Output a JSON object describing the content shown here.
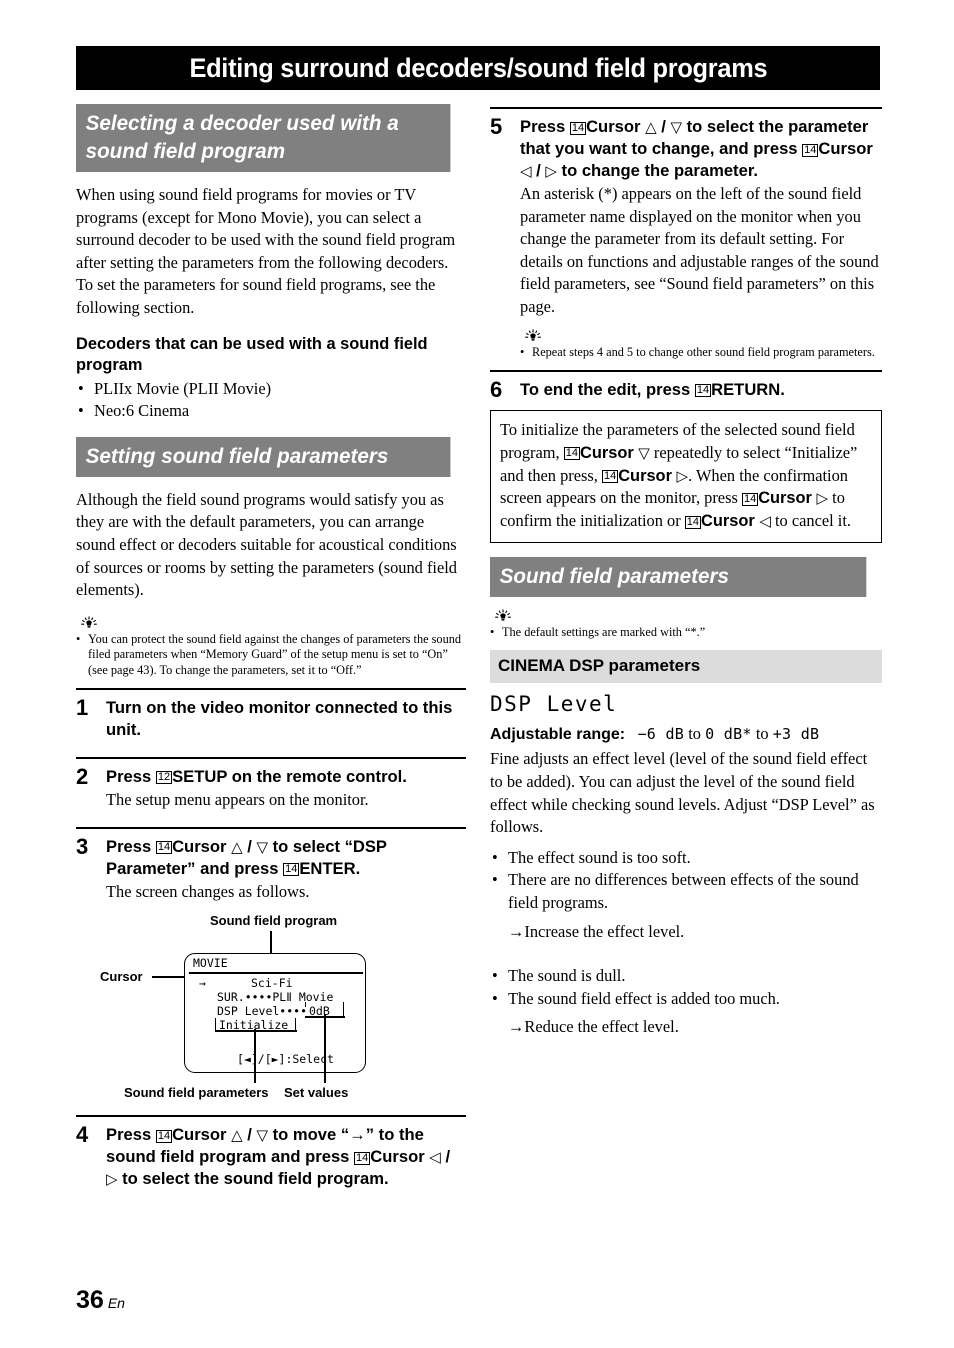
{
  "page": {
    "title": "Editing surround decoders/sound field programs",
    "number": "36",
    "language": "En"
  },
  "left": {
    "section1": {
      "heading": "Selecting a decoder used with a sound field program",
      "paragraph": "When using sound field programs for movies or TV programs (except for Mono Movie), you can select a surround decoder to be used with the sound field program after setting the parameters from the following decoders. To set the parameters for sound field programs, see the following section.",
      "subheading": "Decoders that can be used with a sound field program",
      "bullets": [
        "PLIIx Movie (PLII Movie)",
        "Neo:6 Cinema"
      ]
    },
    "section2": {
      "heading": "Setting sound field parameters",
      "paragraph": "Although the field sound programs would satisfy you as they are with the default parameters, you can arrange sound effect or decoders suitable for acoustical conditions of sources or rooms by setting the parameters (sound field elements).",
      "tip": "You can protect the sound field against the changes of parameters the sound filed parameters when “Memory Guard” of the setup menu is set to “On” (see page 43). To change the parameters, set it to “Off.”"
    },
    "steps": [
      {
        "num": "1",
        "head_parts": [
          {
            "t": "text",
            "v": "Turn on the video monitor connected to this unit."
          }
        ],
        "sub": ""
      },
      {
        "num": "2",
        "head_parts": [
          {
            "t": "text",
            "v": "Press "
          },
          {
            "t": "key",
            "v": "12"
          },
          {
            "t": "text",
            "v": "SETUP"
          },
          {
            "t": "text",
            "v": " on the remote control."
          }
        ],
        "sub": "The setup menu appears on the monitor."
      },
      {
        "num": "3",
        "head_parts": [
          {
            "t": "text",
            "v": "Press "
          },
          {
            "t": "key",
            "v": "14"
          },
          {
            "t": "text",
            "v": "Cursor "
          },
          {
            "t": "glyph",
            "v": "△"
          },
          {
            "t": "text",
            "v": " / "
          },
          {
            "t": "glyph",
            "v": "▽"
          },
          {
            "t": "text",
            "v": " to select “DSP Parameter” and press "
          },
          {
            "t": "key",
            "v": "14"
          },
          {
            "t": "text",
            "v": "ENTER."
          }
        ],
        "sub": "The screen changes as follows."
      }
    ],
    "step4": {
      "num": "4",
      "head_parts": [
        {
          "t": "text",
          "v": "Press "
        },
        {
          "t": "key",
          "v": "14"
        },
        {
          "t": "text",
          "v": "Cursor "
        },
        {
          "t": "glyph",
          "v": "△"
        },
        {
          "t": "text",
          "v": " / "
        },
        {
          "t": "glyph",
          "v": "▽"
        },
        {
          "t": "text",
          "v": " to move “→” to the sound field program and press "
        },
        {
          "t": "key",
          "v": "14"
        },
        {
          "t": "text",
          "v": "Cursor "
        },
        {
          "t": "glyph",
          "v": "◁"
        },
        {
          "t": "text",
          "v": " / "
        },
        {
          "t": "glyph",
          "v": "▷"
        },
        {
          "t": "text",
          "v": " to select the sound field program."
        }
      ]
    },
    "figure": {
      "label_top": "Sound field program",
      "label_cursor": "Cursor",
      "label_bottom_left": "Sound field parameters",
      "label_bottom_right": "Set values",
      "osd": {
        "title": "MOVIE",
        "cursor_arrow": "→",
        "program": "Sci-Fi",
        "line_sur": "SUR.••••PLⅡ Movie",
        "line_dsp": "DSP Level••••",
        "dsp_value": "0dB",
        "line_init": "Initialize",
        "line_select": "[◄]/[►]:Select"
      }
    }
  },
  "right": {
    "step5": {
      "num": "5",
      "head_parts": [
        {
          "t": "text",
          "v": "Press "
        },
        {
          "t": "key",
          "v": "14"
        },
        {
          "t": "text",
          "v": "Cursor "
        },
        {
          "t": "glyph",
          "v": "△"
        },
        {
          "t": "text",
          "v": " / "
        },
        {
          "t": "glyph",
          "v": "▽"
        },
        {
          "t": "text",
          "v": " to select the parameter that you want to change, and press "
        },
        {
          "t": "key",
          "v": "14"
        },
        {
          "t": "text",
          "v": "Cursor "
        },
        {
          "t": "glyph",
          "v": "◁"
        },
        {
          "t": "text",
          "v": " / "
        },
        {
          "t": "glyph",
          "v": "▷"
        },
        {
          "t": "text",
          "v": " to change the parameter."
        }
      ],
      "sub": "An asterisk (*) appears on the left of the sound field parameter name displayed on the monitor when you change the parameter from its default setting. For details on functions and adjustable ranges of the sound field parameters, see “Sound field parameters” on this page.",
      "tip": "Repeat steps 4 and 5 to change other sound field program parameters."
    },
    "step6": {
      "num": "6",
      "head_parts": [
        {
          "t": "text",
          "v": "To end the edit, press "
        },
        {
          "t": "key",
          "v": "14"
        },
        {
          "t": "text",
          "v": "RETURN."
        }
      ]
    },
    "note_box_parts": [
      {
        "t": "text",
        "v": "To initialize the parameters of the selected sound field program, "
      },
      {
        "t": "key",
        "v": "14"
      },
      {
        "t": "bold",
        "v": "Cursor "
      },
      {
        "t": "glyph",
        "v": "▽"
      },
      {
        "t": "text",
        "v": " repeatedly to select “Initialize” and then press, "
      },
      {
        "t": "key",
        "v": "14"
      },
      {
        "t": "bold",
        "v": "Cursor "
      },
      {
        "t": "glyph",
        "v": "▷"
      },
      {
        "t": "text",
        "v": ". When the confirmation screen appears on the monitor, press "
      },
      {
        "t": "key",
        "v": "14"
      },
      {
        "t": "bold",
        "v": "Cursor "
      },
      {
        "t": "glyph",
        "v": "▷"
      },
      {
        "t": "text",
        "v": " to confirm the initialization or "
      },
      {
        "t": "key",
        "v": "14"
      },
      {
        "t": "bold",
        "v": "Cursor "
      },
      {
        "t": "glyph",
        "v": "◁"
      },
      {
        "t": "text",
        "v": " to cancel it."
      }
    ],
    "section3": {
      "heading": "Sound field parameters",
      "tip": "The default settings are marked with “*.”",
      "subbar": "CINEMA DSP parameters",
      "param_name": "DSP Level",
      "range_label": "Adjustable range:",
      "range_value_1": "−6 dB",
      "range_to_1": "to",
      "range_value_2": "0 dB*",
      "range_to_2": "to",
      "range_value_3": "+3 dB",
      "description": "Fine adjusts an effect level (level of the sound field effect to be added). You can adjust the level of the sound field effect while checking sound levels. Adjust “DSP Level” as follows.",
      "bullets_increase": [
        "The effect sound is too soft.",
        "There are no differences between effects of the sound field programs."
      ],
      "result_increase": "→Increase the effect level.",
      "bullets_reduce": [
        "The sound is dull.",
        "The sound field effect is added too much."
      ],
      "result_reduce": "→Reduce the effect level."
    }
  },
  "colors": {
    "section_header_bg": "#808080",
    "subbar_bg": "#dcdcdc",
    "title_bg": "#000000",
    "text": "#000000"
  }
}
